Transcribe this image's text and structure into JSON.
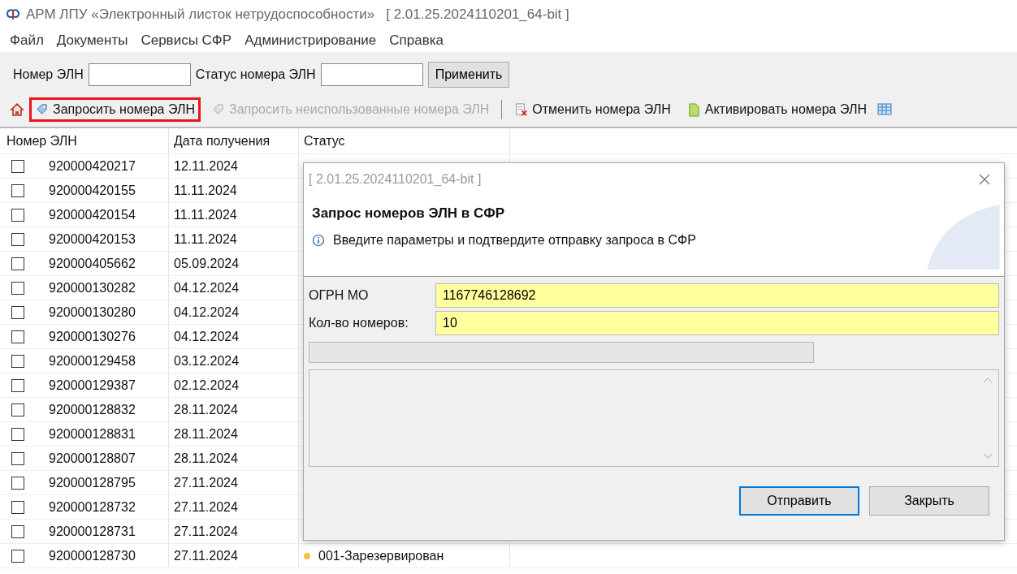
{
  "window": {
    "title": "АРМ ЛПУ «Электронный листок нетрудоспособности»",
    "version": "[ 2.01.25.2024110201_64-bit ]"
  },
  "menu": [
    "Файл",
    "Документы",
    "Сервисы СФР",
    "Администрирование",
    "Справка"
  ],
  "filter": {
    "fields": [
      {
        "label": "Номер ЭЛН"
      },
      {
        "label": "Статус номера ЭЛН"
      }
    ],
    "apply_button": "Применить"
  },
  "toolbar": [
    {
      "kind": "home"
    },
    {
      "kind": "request",
      "label": "Запросить номера ЭЛН",
      "disabled": false,
      "highlighted": true
    },
    {
      "kind": "request",
      "label": "Запросить неиспользованные номера ЭЛН",
      "disabled": true,
      "highlighted": false
    },
    {
      "kind": "separator"
    },
    {
      "kind": "cancel",
      "label": "Отменить номера ЭЛН",
      "disabled": false,
      "highlighted": false
    },
    {
      "kind": "activate",
      "label": "Активировать номера ЭЛН",
      "disabled": false,
      "highlighted": false
    },
    {
      "kind": "table"
    }
  ],
  "table": {
    "columns": [
      "Номер ЭЛН",
      "Дата получения",
      "Статус"
    ],
    "rows": [
      {
        "checked": false,
        "number": "920000420217",
        "date": "12.11.2024"
      },
      {
        "checked": false,
        "number": "920000420155",
        "date": "11.11.2024"
      },
      {
        "checked": false,
        "number": "920000420154",
        "date": "11.11.2024"
      },
      {
        "checked": false,
        "number": "920000420153",
        "date": "11.11.2024"
      },
      {
        "checked": false,
        "number": "920000405662",
        "date": "05.09.2024"
      },
      {
        "checked": false,
        "number": "920000130282",
        "date": "04.12.2024"
      },
      {
        "checked": false,
        "number": "920000130280",
        "date": "04.12.2024"
      },
      {
        "checked": false,
        "number": "920000130276",
        "date": "04.12.2024"
      },
      {
        "checked": false,
        "number": "920000129458",
        "date": "03.12.2024"
      },
      {
        "checked": false,
        "number": "920000129387",
        "date": "02.12.2024"
      },
      {
        "checked": false,
        "number": "920000128832",
        "date": "28.11.2024"
      },
      {
        "checked": false,
        "number": "920000128831",
        "date": "28.11.2024"
      },
      {
        "checked": false,
        "number": "920000128807",
        "date": "28.11.2024"
      },
      {
        "checked": false,
        "number": "920000128795",
        "date": "27.11.2024"
      },
      {
        "checked": false,
        "number": "920000128732",
        "date": "27.11.2024"
      },
      {
        "checked": false,
        "number": "920000128731",
        "date": "27.11.2024"
      },
      {
        "checked": false,
        "number": "920000128730",
        "date": "27.11.2024",
        "status": "001-Зарезервирован",
        "color": "#f5c342"
      }
    ]
  },
  "dialog": {
    "title": "[ 2.01.25.2024110201_64-bit ]",
    "heading": "Запрос номеров ЭЛН в СФР",
    "info": "Введите параметры и подтвердите отправку запроса в СФР",
    "fields": [
      {
        "label": "ОГРН МО",
        "value": "1167746128692"
      },
      {
        "label": "Кол-во номеров:",
        "value": "10"
      }
    ],
    "progress": {
      "level": 0
    },
    "buttons": [
      {
        "label": "Отправить",
        "default": true
      },
      {
        "label": "Закрыть",
        "default": false
      }
    ]
  }
}
